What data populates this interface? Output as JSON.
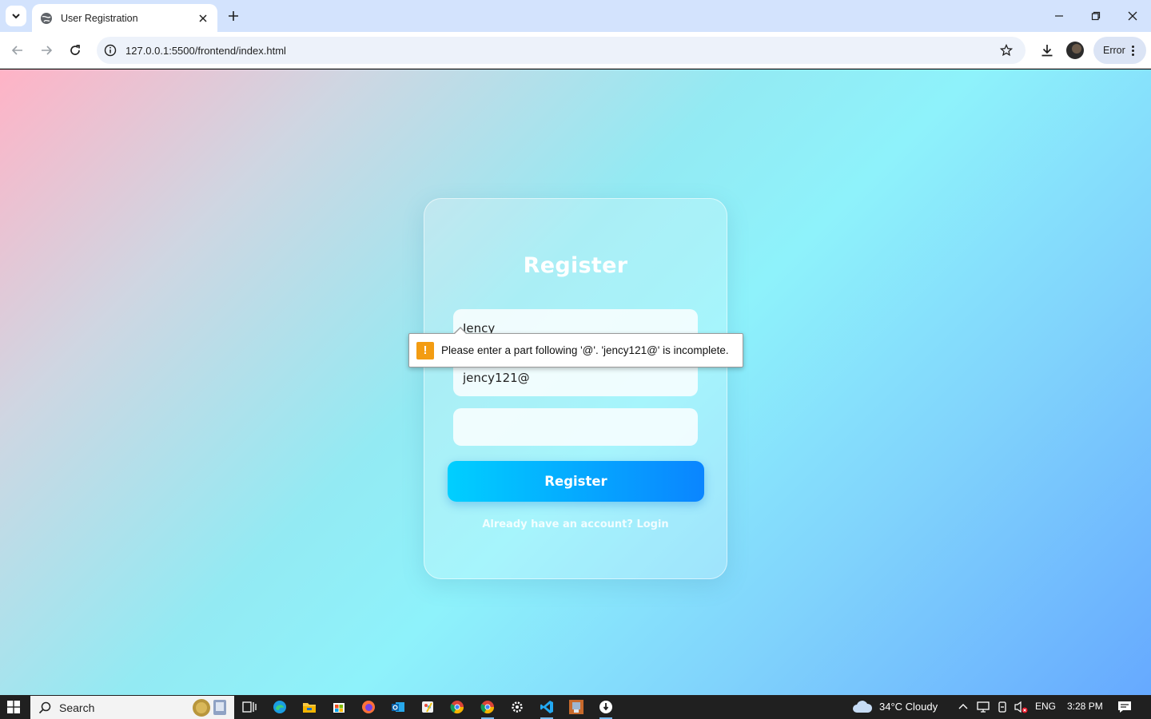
{
  "browser": {
    "tab_title": "User Registration",
    "url": "127.0.0.1:5500/frontend/index.html",
    "error_chip_label": "Error"
  },
  "page": {
    "title": "Register",
    "fields": {
      "name_value": "Jency",
      "email_value": "jency121@",
      "password_value": ""
    },
    "submit_label": "Register",
    "login_link": "Already have an account? Login",
    "validation_message": "Please enter a part following '@'. 'jency121@' is incomplete."
  },
  "taskbar": {
    "search_label": "Search",
    "weather": "34°C  Cloudy",
    "language": "ENG",
    "time": "3:28 PM"
  },
  "colors": {
    "tabbar": "#d3e3fd",
    "button_gradient_start": "#00cfff",
    "button_gradient_end": "#0a85ff",
    "warning": "#f39c12"
  }
}
